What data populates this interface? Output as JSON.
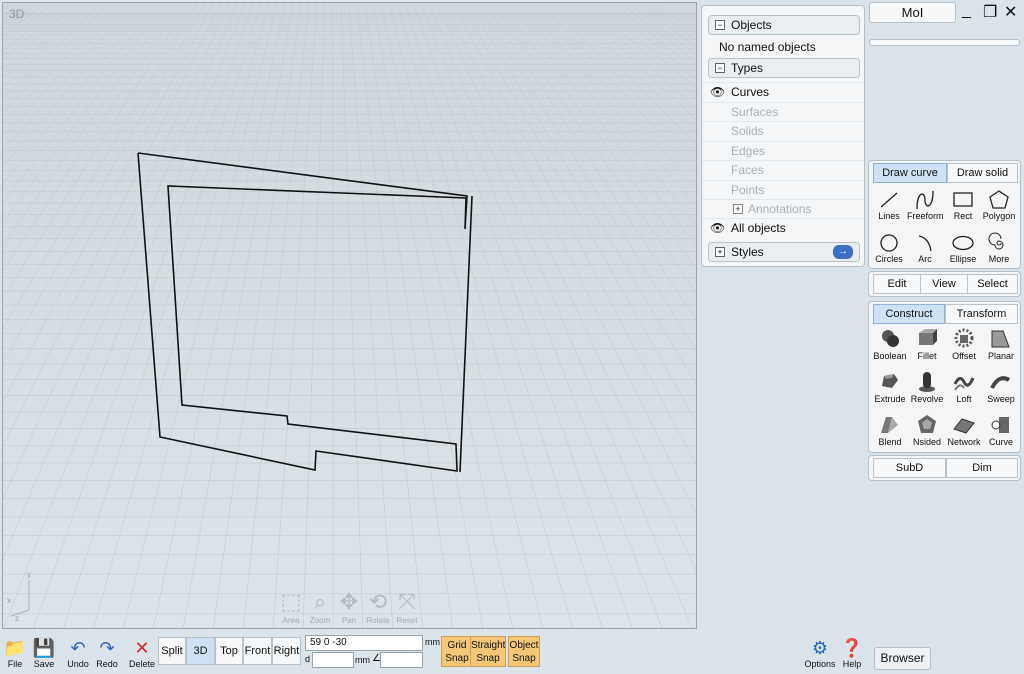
{
  "viewport": {
    "label": "3D",
    "nav": [
      {
        "name": "area",
        "label": "Area",
        "icon": "⬚"
      },
      {
        "name": "zoom",
        "label": "Zoom",
        "icon": "⌕"
      },
      {
        "name": "pan",
        "label": "Pan",
        "icon": "✥"
      },
      {
        "name": "rotate",
        "label": "Rotate",
        "icon": "⟲"
      },
      {
        "name": "reset",
        "label": "Reset",
        "icon": "⤧"
      }
    ],
    "axes": {
      "x": "x",
      "y": "y",
      "z": "z"
    }
  },
  "window": {
    "app_name": "MoI",
    "minimize": "_",
    "maximize": "❐",
    "close": "✕"
  },
  "scene": {
    "objects_header": "Objects",
    "no_named": "No named objects",
    "types_header": "Types",
    "types": [
      {
        "label": "Curves",
        "active": true
      },
      {
        "label": "Surfaces",
        "active": false
      },
      {
        "label": "Solids",
        "active": false
      },
      {
        "label": "Edges",
        "active": false
      },
      {
        "label": "Faces",
        "active": false
      },
      {
        "label": "Points",
        "active": false
      },
      {
        "label": "Annotations",
        "active": false
      },
      {
        "label": "All objects",
        "active": true
      }
    ],
    "styles_header": "Styles",
    "collapse": "−",
    "expand": "+",
    "eye": "👁",
    "arrow": "→"
  },
  "draw": {
    "tabs": [
      "Draw curve",
      "Draw solid"
    ],
    "tools": [
      "Lines",
      "Freeform",
      "Rect",
      "Polygon",
      "Circles",
      "Arc",
      "Ellipse",
      "More"
    ]
  },
  "edit_tabs": [
    "Edit",
    "View",
    "Select"
  ],
  "construct": {
    "tabs": [
      "Construct",
      "Transform"
    ],
    "tools": [
      "Boolean",
      "Fillet",
      "Offset",
      "Planar",
      "Extrude",
      "Revolve",
      "Loft",
      "Sweep",
      "Blend",
      "Nsided",
      "Network",
      "Curve"
    ]
  },
  "sub_tabs": [
    "SubD",
    "Dim"
  ],
  "bottom": {
    "file": "File",
    "save": "Save",
    "undo": "Undo",
    "redo": "Redo",
    "delete": "Delete",
    "views": [
      "Split",
      "3D",
      "Top",
      "Front",
      "Right"
    ],
    "active_view": "3D",
    "coords": "59        0        -30",
    "unit": "mm",
    "d_label": "d",
    "angle_label": "∠",
    "snaps": [
      [
        "Grid",
        "Snap"
      ],
      [
        "Straight",
        "Snap"
      ],
      [
        "Object",
        "Snap"
      ]
    ],
    "options": "Options",
    "help": "Help",
    "browser": "Browser"
  }
}
